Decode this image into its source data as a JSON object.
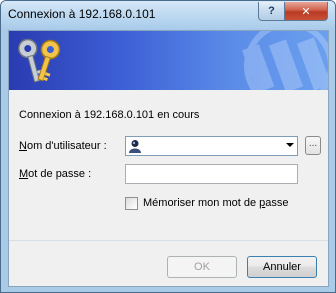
{
  "window": {
    "title": "Connexion à 192.168.0.101",
    "help_label": "?",
    "close_label": "✕"
  },
  "banner": {
    "icon": "keys-icon"
  },
  "status_text": "Connexion à 192.168.0.101 en cours",
  "username": {
    "label_accesskey": "N",
    "label_rest": "om d'utilisateur :",
    "value": "",
    "user_icon": "user-icon",
    "browse_label": "..."
  },
  "password": {
    "label_accesskey": "M",
    "label_rest": "ot de passe :",
    "value": ""
  },
  "remember": {
    "label_before": "Mémoriser mon mot de ",
    "label_accesskey": "p",
    "label_after": "asse",
    "checked": false
  },
  "buttons": {
    "ok": "OK",
    "cancel": "Annuler"
  },
  "colors": {
    "banner_start": "#2a3bb0",
    "banner_end": "#6aa0ee",
    "client_bg": "#f0f0f0",
    "close_red": "#c95238"
  }
}
